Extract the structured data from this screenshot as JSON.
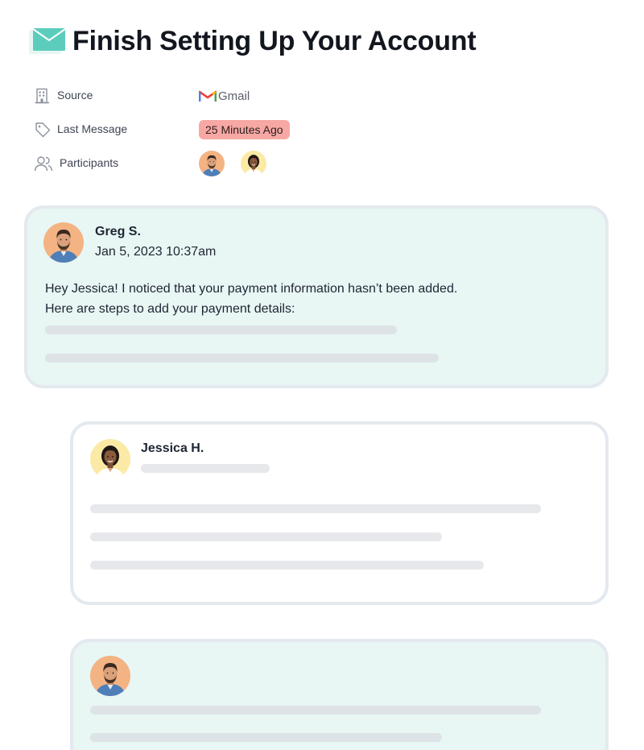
{
  "header": {
    "title": "Finish Setting Up Your Account",
    "icon": "mail-icon",
    "icon_color": "#5ccdbd"
  },
  "meta": {
    "source": {
      "label": "Source",
      "value": "Gmail",
      "icon": "building-icon"
    },
    "last_message": {
      "label": "Last Message",
      "value": "25 Minutes Ago",
      "icon": "tag-icon",
      "badge_color": "#f7a8a4"
    },
    "participants": {
      "label": "Participants",
      "icon": "users-icon"
    }
  },
  "thread": {
    "messages": [
      {
        "author": "Greg S.",
        "date": "Jan 5, 2023 10:37am",
        "lines": [
          "Hey Jessica! I noticed that your payment information hasn’t been added.",
          "Here are steps to add your payment details:"
        ],
        "background": "#e8f6f4"
      },
      {
        "author": "Jessica H.",
        "background": "#ffffff"
      },
      {
        "background": "#e8f6f4"
      }
    ]
  },
  "colors": {
    "card_border": "#e4e9ef",
    "placeholder": "#dde3e6"
  }
}
